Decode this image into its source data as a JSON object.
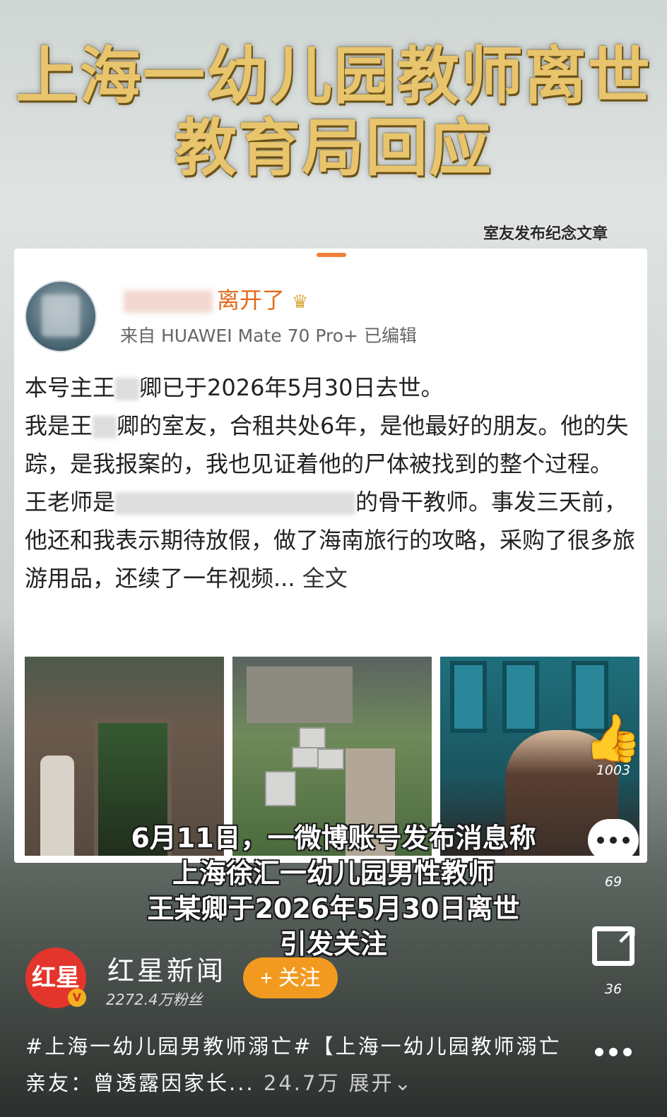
{
  "headline": {
    "line1": "上海一幼儿园教师离世",
    "line2": "教育局回应"
  },
  "stamp": "室友发布纪念文章",
  "post": {
    "username_suffix": "离开了",
    "device": "来自 HUAWEI Mate 70 Pro+  已编辑",
    "paragraphs": [
      {
        "pre": "本号主王",
        "post": "卿已于2026年5月30日去世。"
      },
      {
        "pre": "我是王",
        "post": "卿的室友，合租共处6年，是他最好的朋友。他的失踪，是我报案的，我也见证着他的尸体被找到的整个过程。"
      },
      {
        "pre": "王老师是",
        "post": "的骨干教师。事发三天前，他还和我表示期待放假，做了海南旅行的攻略，采购了很多旅游用品，还续了一年视频..."
      }
    ],
    "more_label": "全文"
  },
  "captions": [
    "6月11日，一微博账号发布消息称",
    "上海徐汇一幼儿园男性教师",
    "王某卿于2026年5月30日离世",
    "引发关注"
  ],
  "actions": {
    "like_count": "1003",
    "comment_count": "69",
    "share_count": "36"
  },
  "account": {
    "logo_text": "红星",
    "name": "红星新闻",
    "fans": "2272.4万粉丝",
    "follow_label": "+ 关注"
  },
  "description": {
    "text": "#上海一幼儿园男教师溺亡#【上海一幼儿园教师溺亡亲友：曾透露因家长...",
    "views": "24.7万",
    "expand_label": "展开"
  }
}
